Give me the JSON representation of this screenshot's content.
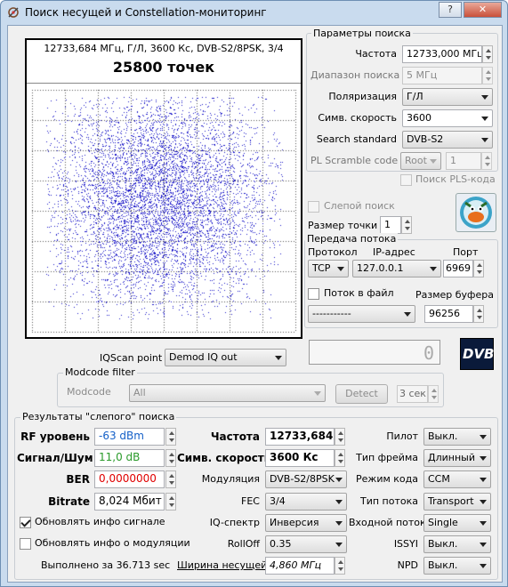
{
  "window": {
    "title": "Поиск несущей и Constellation-мониторинг"
  },
  "constellation": {
    "header": "12733,684 МГц, Г/Л, 3600 Кс, DVB-S2/8PSK, 3/4",
    "points_label": "25800 точек"
  },
  "search_params": {
    "group_title": "Параметры поиска",
    "frequency_label": "Частота",
    "frequency_value": "12733,000 МГц",
    "range_label": "Диапазон поиска",
    "range_value": "5 МГц",
    "polarization_label": "Поляризация",
    "polarization_value": "Г/Л",
    "symrate_label": "Симв. скорость",
    "symrate_value": "3600",
    "standard_label": "Search standard",
    "standard_value": "DVB-S2",
    "pl_label": "PL Scramble code",
    "pl_mode": "Root",
    "pl_value": "1",
    "pls_search_label": "Поиск PLS-кода"
  },
  "blind": {
    "label": "Слепой поиск",
    "pointsize_label": "Размер точки",
    "pointsize_value": "1"
  },
  "stream": {
    "group_title": "Передача потока",
    "protocol_label": "Протокол",
    "ip_label": "IP-адрес",
    "port_label": "Порт",
    "protocol_value": "TCP",
    "ip_value": "127.0.0.1",
    "port_value": "6969",
    "file_label": "Поток в файл",
    "buffer_label": "Размер буфера",
    "file_value": "-----------",
    "buffer_value": "96256"
  },
  "iqscan": {
    "label": "IQScan point",
    "value": "Demod IQ out"
  },
  "modcode": {
    "group_title": "Modcode filter",
    "label": "Modcode",
    "value": "All",
    "detect_label": "Detect",
    "sec_value": "3 сек"
  },
  "dvb_logo": "DVB",
  "results": {
    "group_title": "Результаты \"слепого\" поиска",
    "rf_label": "RF уровень",
    "rf_value": "-63 dBm",
    "snr_label": "Сигнал/Шум",
    "snr_value": "11,0 dB",
    "ber_label": "BER",
    "ber_value": "0,0000000",
    "bitrate_label": "Bitrate",
    "bitrate_value": "8,024 Мбит",
    "upd_signal_label": "Обновлять инфо сигнале",
    "upd_mod_label": "Обновлять инфо о модуляции",
    "done_label": "Выполнено за 36.713 sec",
    "freq_label": "Частота",
    "freq_value": "12733,684 МГц",
    "sym_label": "Симв. скорость",
    "sym_value": "3600 Кс",
    "mod_label": "Модуляция",
    "mod_value": "DVB-S2/8PSK",
    "fec_label": "FEC",
    "fec_value": "3/4",
    "iq_label": "IQ-спектр",
    "iq_value": "Инверсия",
    "rolloff_label": "RollOff",
    "rolloff_value": "0.35",
    "width_label": "Ширина несущей",
    "width_value": "4,860 МГц",
    "pilot_label": "Пилот",
    "pilot_value": "Выкл.",
    "frame_label": "Тип фрейма",
    "frame_value": "Длинный",
    "codemode_label": "Режим кода",
    "codemode_value": "CCM",
    "streamtype_label": "Тип потока",
    "streamtype_value": "Transport",
    "input_label": "Входной поток",
    "input_value": "Single",
    "issyi_label": "ISSYI",
    "issyi_value": "Выкл.",
    "npd_label": "NPD",
    "npd_value": "Выкл."
  },
  "colors": {
    "accent_blue": "#1560c8",
    "snr_green": "#2a9a2a",
    "ber_red": "#e00000",
    "points": "#1a16c8"
  }
}
